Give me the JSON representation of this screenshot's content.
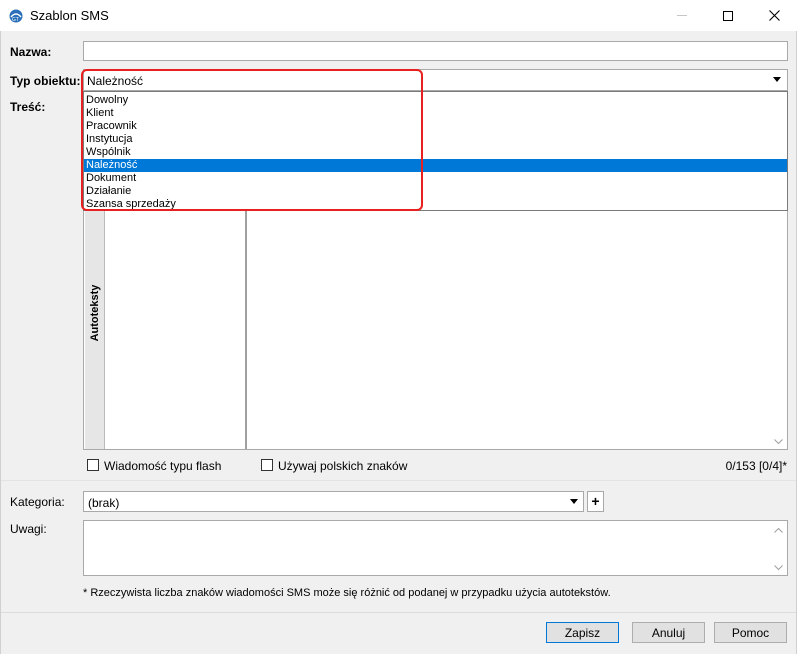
{
  "window": {
    "title": "Szablon SMS"
  },
  "form": {
    "nazwa_label": "Nazwa:",
    "nazwa_value": "",
    "typ_label": "Typ obiektu:",
    "typ_value": "Należność",
    "tresc_label": "Treść:",
    "typ_options": [
      "Dowolny",
      "Klient",
      "Pracownik",
      "Instytucja",
      "Wspólnik",
      "Należność",
      "Dokument",
      "Działanie",
      "Szansa sprzedaży"
    ],
    "typ_selected_index": 5,
    "autotexts_label": "Autoteksty",
    "flash_label": "Wiadomość typu flash",
    "polish_label": "Używaj polskich znaków",
    "counter": "0/153 [0/4]*",
    "kategoria_label": "Kategoria:",
    "kategoria_value": "(brak)",
    "plus_label": "+",
    "uwagi_label": "Uwagi:",
    "footnote": "* Rzeczywista liczba znaków wiadomości SMS może się różnić od podanej w przypadku użycia autotekstów."
  },
  "buttons": {
    "save": "Zapisz",
    "cancel": "Anuluj",
    "help": "Pomoc"
  },
  "colors": {
    "selection": "#0078d7",
    "highlight_border": "#e82020"
  }
}
